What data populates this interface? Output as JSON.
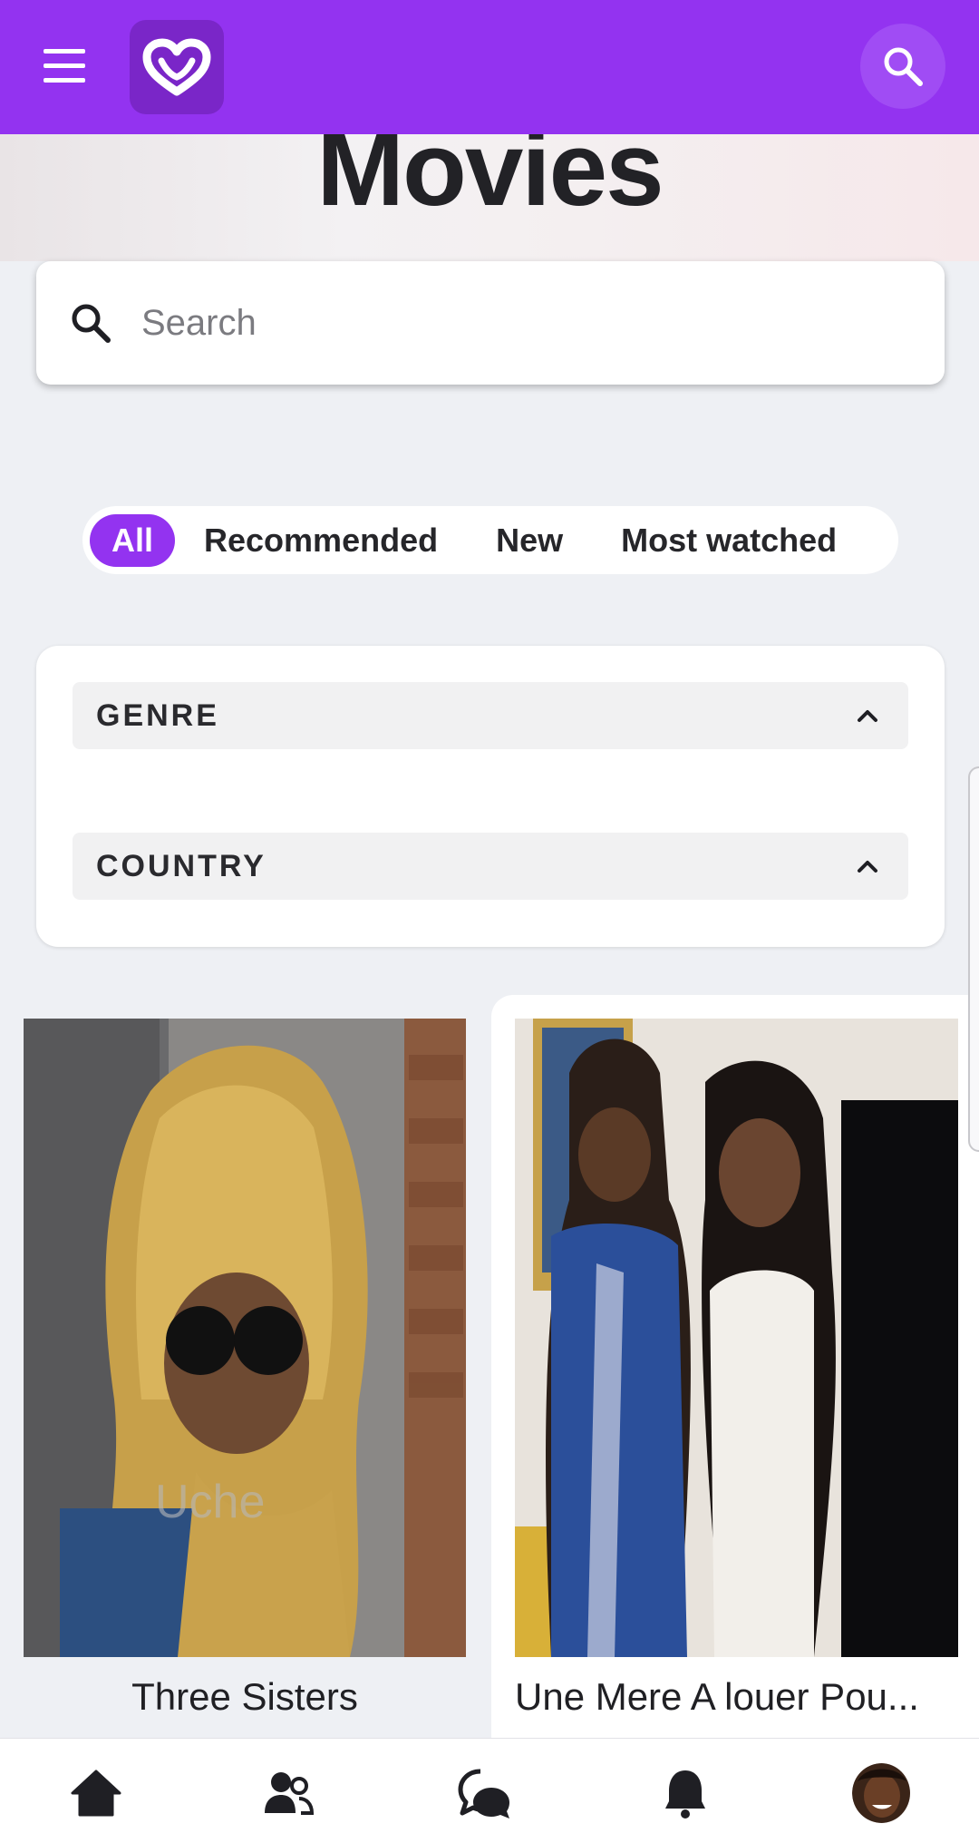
{
  "colors": {
    "brand": "#9333f0",
    "background": "#eef0f4"
  },
  "header": {
    "menu_icon": "hamburger-menu-icon",
    "logo_icon": "heart-logo-icon",
    "search_icon": "search-icon"
  },
  "page": {
    "title": "Movies"
  },
  "search": {
    "placeholder": "Search",
    "value": ""
  },
  "filters": {
    "chips": [
      {
        "label": "All",
        "active": true
      },
      {
        "label": "Recommended",
        "active": false
      },
      {
        "label": "New",
        "active": false
      },
      {
        "label": "Most watched",
        "active": false
      }
    ],
    "sections": [
      {
        "label": "GENRE",
        "icon": "chevron-up-icon"
      },
      {
        "label": "COUNTRY",
        "icon": "chevron-up-icon"
      }
    ]
  },
  "movies": [
    {
      "title": "Three Sisters"
    },
    {
      "title": "Une Mere A louer Pou..."
    }
  ],
  "bottom_nav": [
    {
      "icon": "home-icon"
    },
    {
      "icon": "users-icon"
    },
    {
      "icon": "chat-icon"
    },
    {
      "icon": "bell-icon"
    },
    {
      "icon": "avatar"
    }
  ]
}
